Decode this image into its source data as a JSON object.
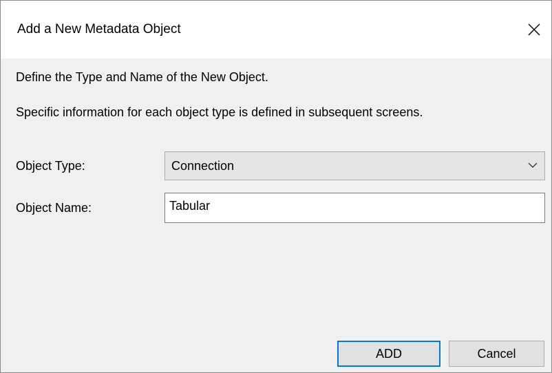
{
  "window": {
    "title": "Add a New Metadata Object",
    "close_icon": "close-icon"
  },
  "intro": {
    "line1": "Define the Type and Name of the New Object.",
    "line2": "Specific information for each object type is defined in subsequent screens."
  },
  "form": {
    "object_type_label": "Object Type:",
    "object_type_value": "Connection",
    "object_type_dropdown_icon": "chevron-down-icon",
    "object_name_label": "Object Name:",
    "object_name_value": "Tabular"
  },
  "buttons": {
    "add_label": "ADD",
    "cancel_label": "Cancel"
  },
  "colors": {
    "title_background": "#ffffff",
    "dialog_background": "#f0f0f0",
    "default_button_border": "#0078d7",
    "button_background": "#e1e1e1",
    "combo_background": "#e5e5e5"
  }
}
